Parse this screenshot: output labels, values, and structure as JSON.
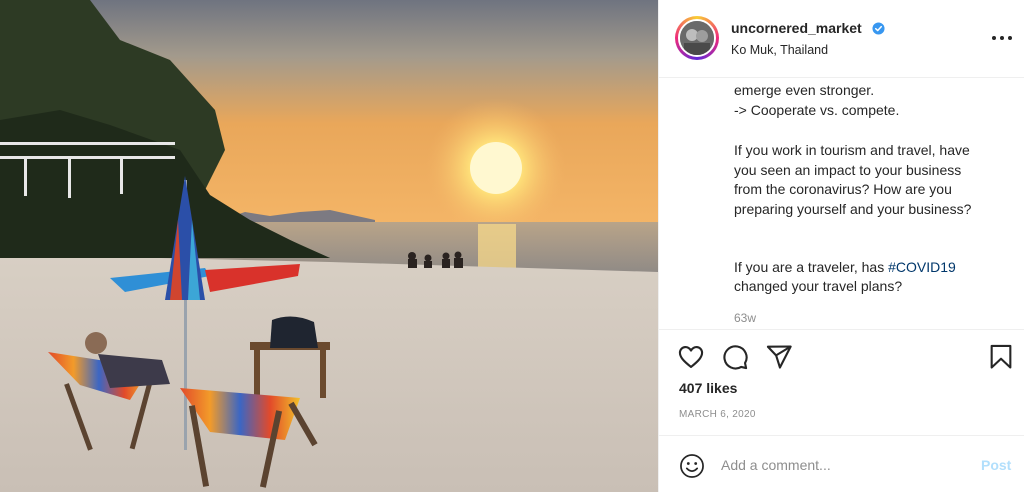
{
  "post": {
    "image_alt": "Sunset beach with chairs, umbrella and kayaks"
  },
  "header": {
    "username": "uncornered_market",
    "location": "Ko Muk, Thailand",
    "verified_icon": "verified-badge-icon",
    "more_icon": "more-options-icon"
  },
  "caption": {
    "clipped_line": "— partial line —",
    "lines": [
      "emerge even stronger.",
      "-> Cooperate vs. compete.",
      "",
      "If you work in tourism and travel, have",
      "you seen an impact to your business",
      "from the coronavirus? How are you",
      "preparing yourself and your business?",
      "",
      "",
      "changed your travel plans?"
    ],
    "hashtag_line_prefix": "If you are a traveler, has ",
    "hashtag": "#COVID19",
    "age": "63w"
  },
  "actions": {
    "like_icon": "heart-icon",
    "comment_icon": "comment-icon",
    "share_icon": "share-icon",
    "save_icon": "bookmark-icon",
    "likes": "407 likes",
    "date": "MARCH 6, 2020"
  },
  "comment_bar": {
    "emoji_icon": "emoji-icon",
    "placeholder": "Add a comment...",
    "post_label": "Post"
  },
  "colors": {
    "link": "#00376b",
    "post_disabled": "#b2dffc",
    "muted": "#8e8e8e",
    "text": "#262626",
    "verified": "#3897f0"
  }
}
